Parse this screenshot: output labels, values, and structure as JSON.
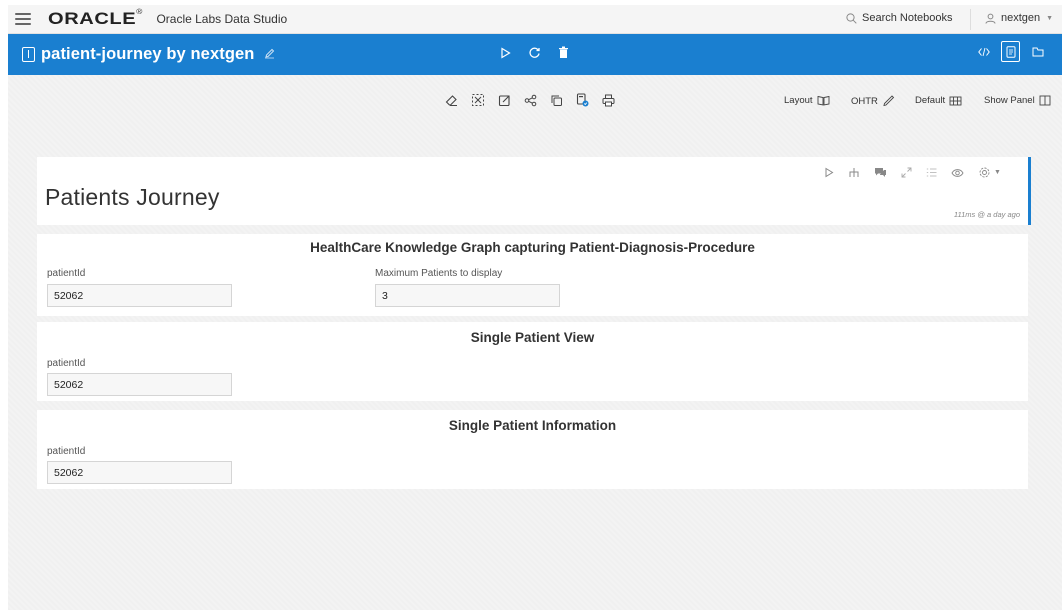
{
  "topbar": {
    "brand": "ORACLE",
    "app_name": "Oracle Labs Data Studio",
    "search_label": "Search Notebooks",
    "user": "nextgen"
  },
  "notebook": {
    "title": "patient-journey by nextgen"
  },
  "toolbar": {
    "layout_label": "Layout",
    "ohtr_label": "OHTR",
    "default_label": "Default",
    "show_panel_label": "Show Panel"
  },
  "title_paragraph": {
    "title": "Patients Journey",
    "timing": "111ms @ a day ago"
  },
  "paragraphs": [
    {
      "heading": "HealthCare Knowledge Graph capturing Patient-Diagnosis-Procedure",
      "fields": [
        {
          "label": "patientId",
          "value": "52062"
        },
        {
          "label": "Maximum Patients to display",
          "value": "3"
        }
      ]
    },
    {
      "heading": "Single Patient View",
      "fields": [
        {
          "label": "patientId",
          "value": "52062"
        }
      ]
    },
    {
      "heading": "Single Patient Information",
      "fields": [
        {
          "label": "patientId",
          "value": "52062"
        }
      ]
    }
  ],
  "colors": {
    "accent": "#1a7fd0",
    "page_bg": "#f3f3f3"
  }
}
